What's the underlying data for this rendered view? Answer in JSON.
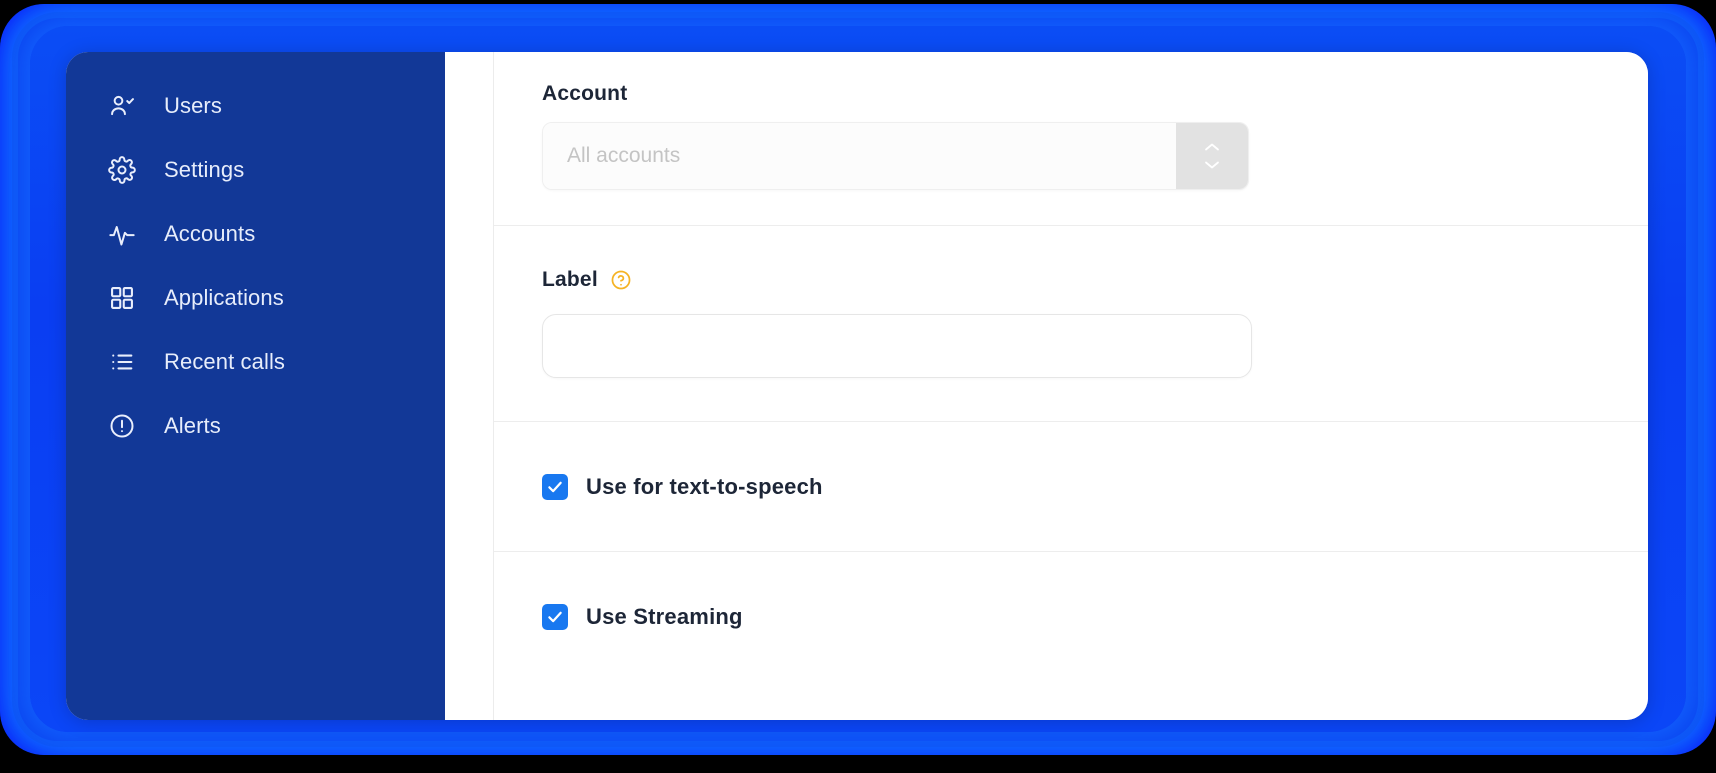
{
  "colors": {
    "frame_glow": "#0b46f0",
    "sidebar_bg": "#123897",
    "accent_checkbox": "#1878f0",
    "help_icon": "#f5b324",
    "text_dark": "#1d2637",
    "placeholder": "#c4c4c4",
    "stepper_bg": "#e2e2e2"
  },
  "sidebar": {
    "items": [
      {
        "label": "Users",
        "icon": "user-check-icon"
      },
      {
        "label": "Settings",
        "icon": "gear-icon"
      },
      {
        "label": "Accounts",
        "icon": "pulse-icon"
      },
      {
        "label": "Applications",
        "icon": "grid-icon"
      },
      {
        "label": "Recent calls",
        "icon": "list-icon"
      },
      {
        "label": "Alerts",
        "icon": "alert-circle-icon"
      }
    ]
  },
  "form": {
    "account": {
      "title": "Account",
      "placeholder": "All accounts",
      "value": "",
      "stepper_up_icon": "chevron-up-icon",
      "stepper_down_icon": "chevron-down-icon"
    },
    "label": {
      "title": "Label",
      "help_icon": "question-circle-icon",
      "value": "",
      "placeholder": ""
    },
    "checkboxes": [
      {
        "label": "Use for text-to-speech",
        "checked": true
      },
      {
        "label": "Use Streaming",
        "checked": true
      }
    ]
  }
}
